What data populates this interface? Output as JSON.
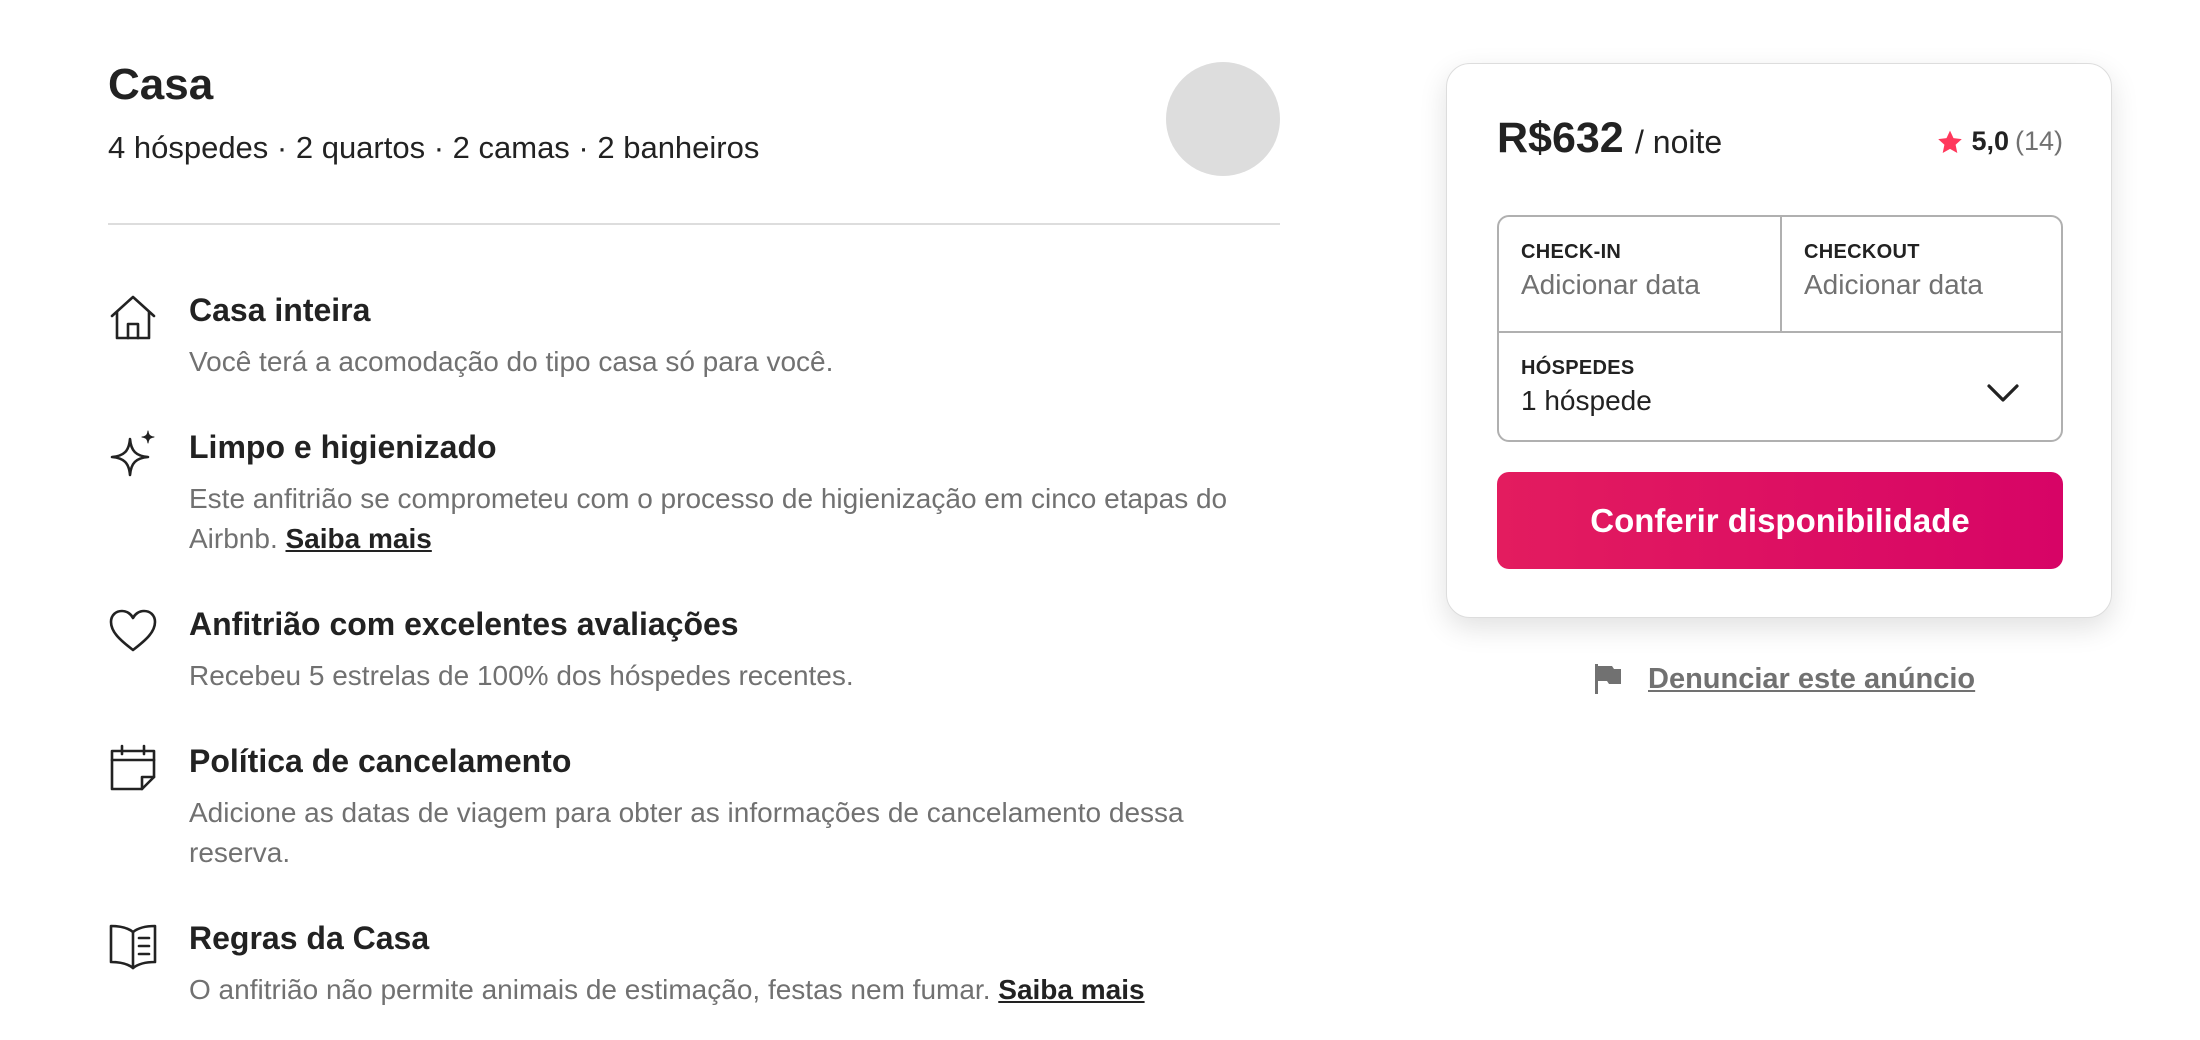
{
  "listing": {
    "title": "Casa",
    "details": "4 hóspedes · 2 quartos · 2 camas · 2 banheiros"
  },
  "features": [
    {
      "icon": "home-icon",
      "title": "Casa inteira",
      "description": "Você terá a acomodação do tipo casa só para você."
    },
    {
      "icon": "sparkles-icon",
      "title": "Limpo e higienizado",
      "description": "Este anfitrião se comprometeu com o processo de higienização em cinco etapas do Airbnb.",
      "link": "Saiba mais"
    },
    {
      "icon": "heart-icon",
      "title": "Anfitrião com excelentes avaliações",
      "description": "Recebeu 5 estrelas de 100% dos hóspedes recentes."
    },
    {
      "icon": "calendar-icon",
      "title": "Política de cancelamento",
      "description": "Adicione as datas de viagem para obter as informações de cancelamento dessa reserva."
    },
    {
      "icon": "book-icon",
      "title": "Regras da Casa",
      "description": "O anfitrião não permite animais de estimação, festas nem fumar.",
      "link": "Saiba mais"
    }
  ],
  "booking": {
    "price": "R$632",
    "per_night": "/ noite",
    "rating": "5,0",
    "reviews": "(14)",
    "checkin_label": "CHECK-IN",
    "checkin_value": "Adicionar data",
    "checkout_label": "CHECKOUT",
    "checkout_value": "Adicionar data",
    "guests_label": "HÓSPEDES",
    "guests_value": "1 hóspede",
    "cta_label": "Conferir disponibilidade"
  },
  "report": {
    "label": "Denunciar este anúncio",
    "icon": "flag-icon"
  },
  "colors": {
    "accent": "#E31C5F",
    "text": "#222222",
    "muted": "#717171"
  }
}
